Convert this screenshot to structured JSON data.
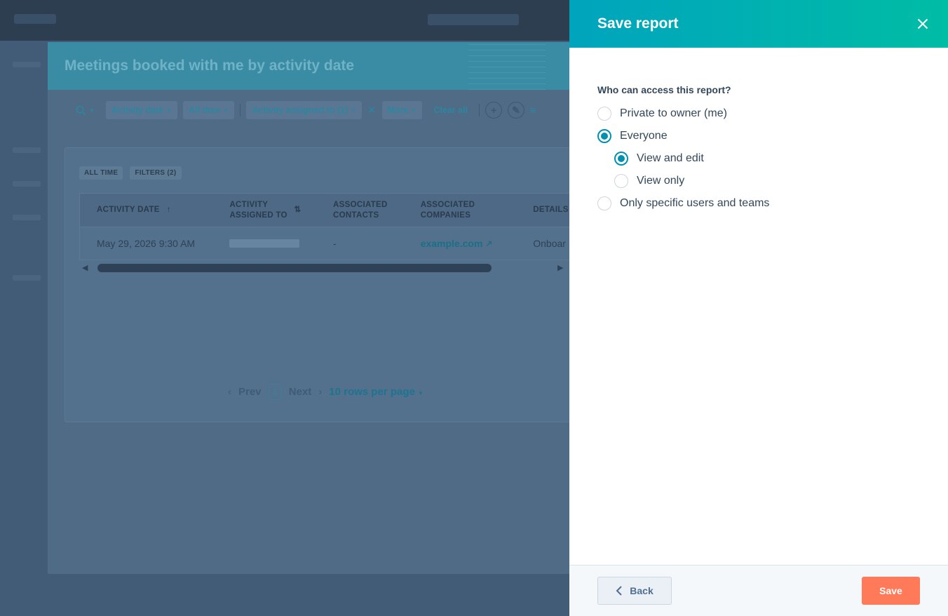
{
  "background": {
    "report_title": "Meetings booked with me by activity date",
    "filters": {
      "activity_date": "Activity date",
      "all_time": "All time",
      "activity_assigned": "Activity assigned to (1)",
      "more": "More",
      "clear_all": "Clear all"
    },
    "chips": [
      "ALL TIME",
      "FILTERS (2)"
    ],
    "table": {
      "headers": [
        "ACTIVITY DATE",
        "ACTIVITY ASSIGNED TO",
        "ASSOCIATED CONTACTS",
        "ASSOCIATED COMPANIES",
        "DETAILS"
      ],
      "row": {
        "activity_date": "May 29, 2026 9:30 AM",
        "contacts": "-",
        "company": "example.com",
        "details": "Onboar"
      }
    },
    "pagination": {
      "prev": "Prev",
      "page": "1",
      "next": "Next",
      "rows_per_page": "10 rows per page"
    }
  },
  "panel": {
    "title": "Save report",
    "question": "Who can access this report?",
    "options": {
      "private": "Private to owner (me)",
      "everyone": "Everyone",
      "view_edit": "View and edit",
      "view_only": "View only",
      "specific": "Only specific users and teams"
    },
    "selected": "everyone",
    "sub_selected": "view_edit",
    "back_label": "Back",
    "save_label": "Save"
  },
  "colors": {
    "accent": "#0091ae",
    "header_gradient_start": "#00a4bd",
    "header_gradient_end": "#00bda5",
    "save_button": "#ff7a59"
  }
}
